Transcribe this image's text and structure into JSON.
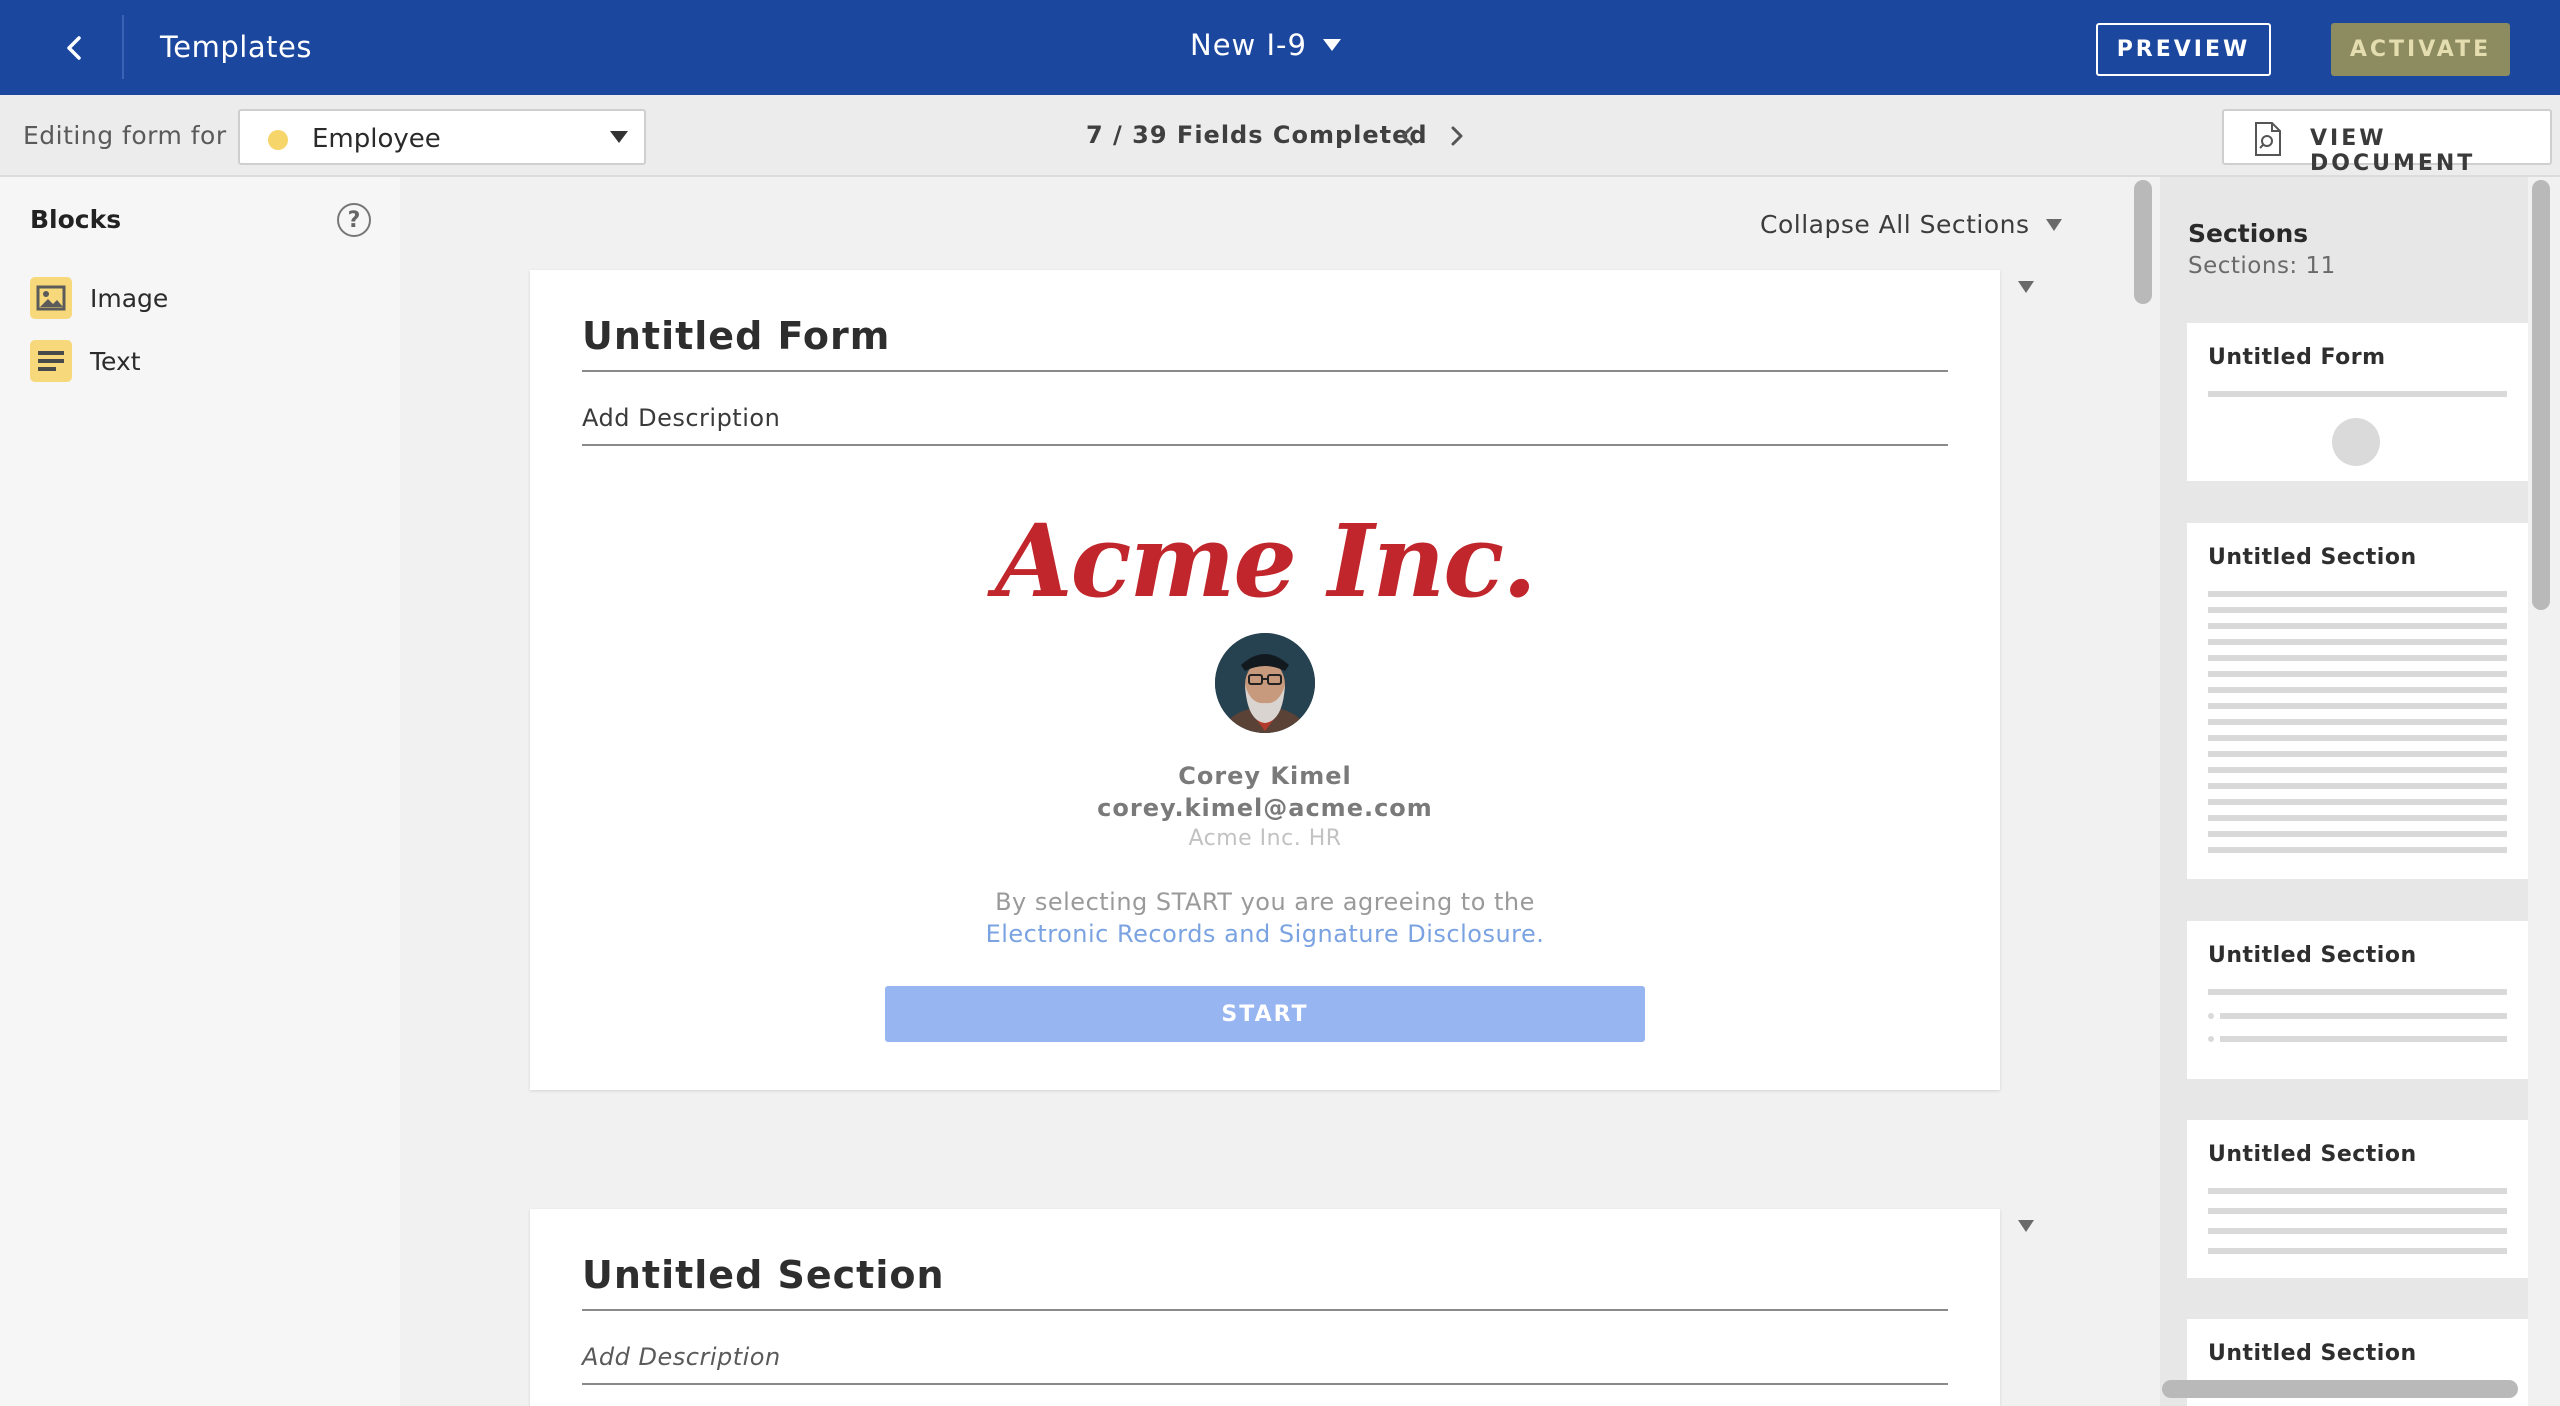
{
  "header": {
    "title": "Templates",
    "document_name": "New I-9",
    "preview_label": "PREVIEW",
    "activate_label": "ACTIVATE"
  },
  "subbar": {
    "editing_label": "Editing form for",
    "role": "Employee",
    "fields_completed": "7 / 39 Fields Completed",
    "view_document_label": "VIEW DOCUMENT"
  },
  "sidebar": {
    "title": "Blocks",
    "help": "?",
    "blocks": [
      {
        "label": "Image",
        "icon": "image-icon"
      },
      {
        "label": "Text",
        "icon": "text-lines-icon"
      }
    ]
  },
  "canvas": {
    "collapse_all_label": "Collapse All Sections",
    "form_card": {
      "title": "Untitled Form",
      "description": "Add Description",
      "logo_text": "Acme Inc.",
      "person_name": "Corey Kimel",
      "person_email": "corey.kimel@acme.com",
      "person_org": "Acme Inc. HR",
      "agree_text": "By selecting START you are agreeing to the",
      "disclosure_link": "Electronic Records and Signature Disclosure.",
      "start_label": "START"
    },
    "section_card": {
      "title": "Untitled Section",
      "description_placeholder": "Add Description"
    }
  },
  "sections_panel": {
    "title": "Sections",
    "count_label": "Sections: 11",
    "items": [
      {
        "title": "Untitled Form"
      },
      {
        "title": "Untitled Section"
      },
      {
        "title": "Untitled Section"
      },
      {
        "title": "Untitled Section"
      },
      {
        "title": "Untitled Section"
      }
    ]
  },
  "colors": {
    "header_bg": "#1b479f",
    "activate_bg": "#8d8b60",
    "logo_red": "#c0262b",
    "start_button": "#97b5f0",
    "link_blue": "#7ba3e2",
    "block_icon_yellow": "#f7d87a"
  }
}
